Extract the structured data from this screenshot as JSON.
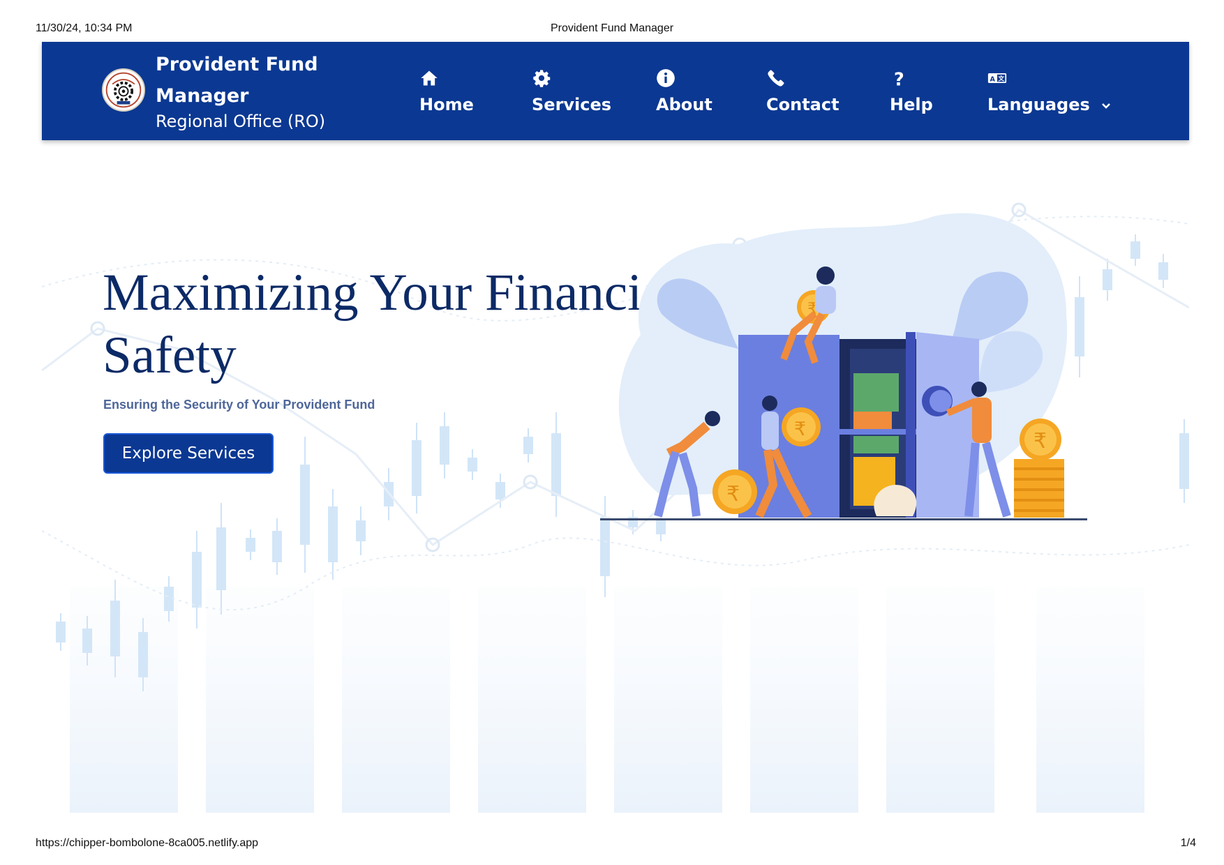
{
  "print": {
    "datetime": "11/30/24, 10:34 PM",
    "title": "Provident Fund Manager",
    "url": "https://chipper-bombolone-8ca005.netlify.app",
    "page": "1/4"
  },
  "navbar": {
    "brand_title": "Provident Fund Manager",
    "brand_subtitle": "Regional Office (RO)",
    "items": [
      {
        "label": "Home",
        "icon": "home-icon"
      },
      {
        "label": "Services",
        "icon": "gear-icon"
      },
      {
        "label": "About",
        "icon": "info-icon"
      },
      {
        "label": "Contact",
        "icon": "phone-icon"
      },
      {
        "label": "Help",
        "icon": "question-icon"
      },
      {
        "label": "Languages",
        "icon": "language-icon"
      }
    ]
  },
  "hero": {
    "title": "Maximizing Your Financia\nSafety",
    "subtitle": "Ensuring the Security of Your Provident Fund",
    "cta_label": "Explore Services"
  },
  "colors": {
    "navbar_bg": "#0b3892",
    "title_color": "#0c2a66",
    "subtitle_color": "#4e6699",
    "button_bg": "#0b3892"
  }
}
